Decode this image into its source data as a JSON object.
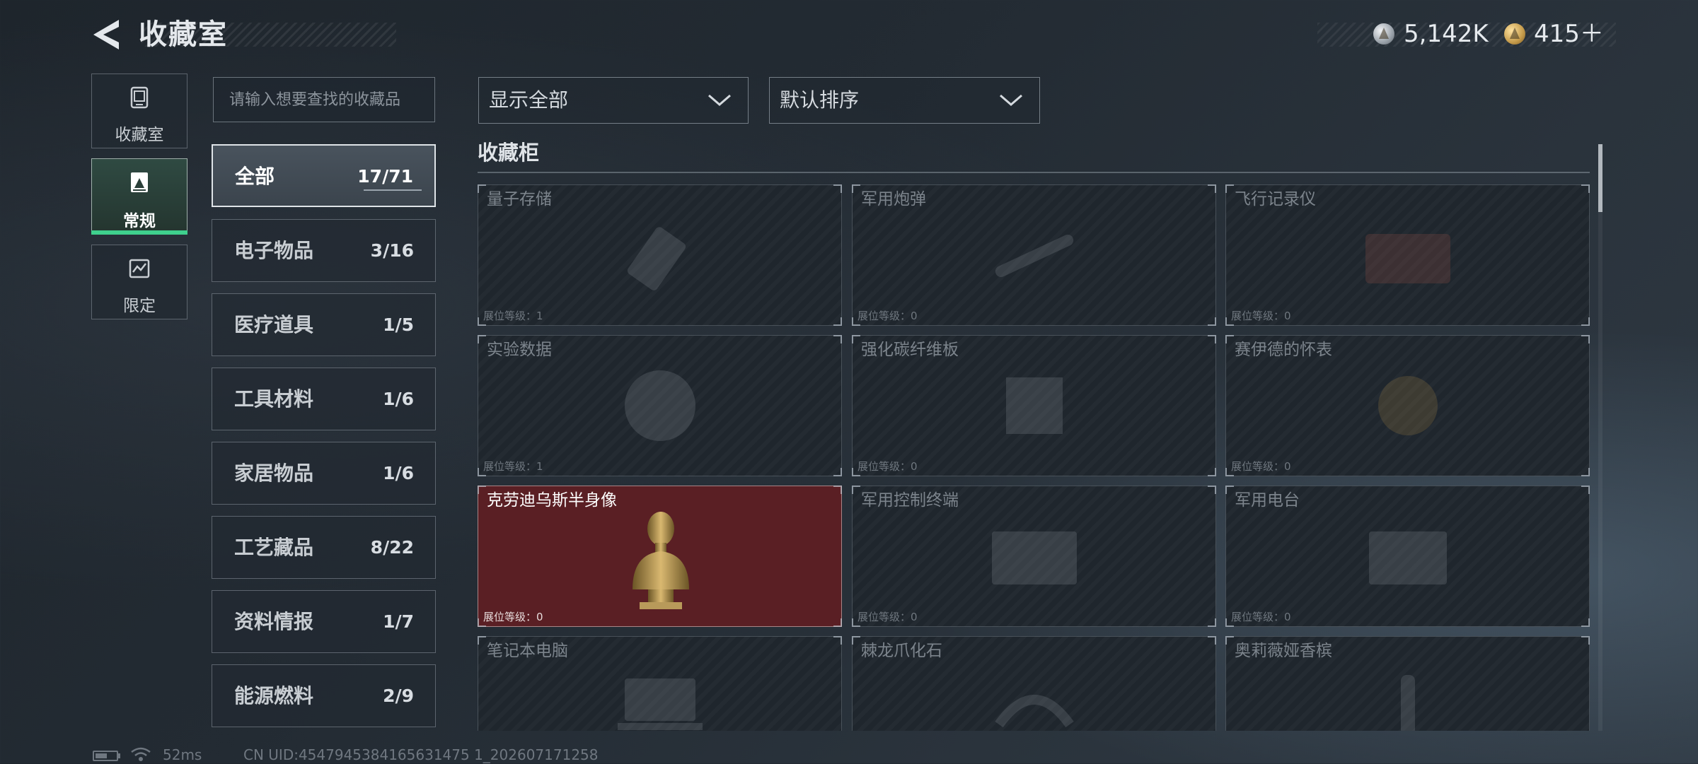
{
  "header": {
    "title": "收藏室",
    "currencies": [
      {
        "icon": "silver-coin-icon",
        "amount": "5,142K"
      },
      {
        "icon": "gold-coin-icon",
        "amount": "415＋"
      }
    ]
  },
  "mode_tabs": [
    {
      "icon": "collection-room-icon",
      "label": "收藏室",
      "active": false
    },
    {
      "icon": "regular-icon",
      "label": "常规",
      "active": true
    },
    {
      "icon": "limited-icon",
      "label": "限定",
      "active": false
    }
  ],
  "search": {
    "placeholder": "请输入想要查找的收藏品"
  },
  "categories": [
    {
      "label": "全部",
      "count": "17/71",
      "active": true
    },
    {
      "label": "电子物品",
      "count": "3/16"
    },
    {
      "label": "医疗道具",
      "count": "1/5"
    },
    {
      "label": "工具材料",
      "count": "1/6"
    },
    {
      "label": "家居物品",
      "count": "1/6"
    },
    {
      "label": "工艺藏品",
      "count": "8/22"
    },
    {
      "label": "资料情报",
      "count": "1/7"
    },
    {
      "label": "能源燃料",
      "count": "2/9"
    }
  ],
  "filters": {
    "display": "显示全部",
    "sort": "默认排序"
  },
  "section": {
    "title": "收藏柜"
  },
  "level_prefix": "展位等级：",
  "items": [
    {
      "name": "量子存储",
      "level": "1",
      "owned": false,
      "icon": "usb-drive-icon"
    },
    {
      "name": "军用炮弹",
      "level": "0",
      "owned": false,
      "icon": "artillery-shell-icon"
    },
    {
      "name": "飞行记录仪",
      "level": "0",
      "owned": false,
      "icon": "flight-recorder-icon"
    },
    {
      "name": "实验数据",
      "level": "1",
      "owned": false,
      "icon": "data-disc-icon"
    },
    {
      "name": "强化碳纤维板",
      "level": "0",
      "owned": false,
      "icon": "carbon-plate-icon"
    },
    {
      "name": "赛伊德的怀表",
      "level": "0",
      "owned": false,
      "icon": "pocket-watch-icon"
    },
    {
      "name": "克劳迪乌斯半身像",
      "level": "0",
      "owned": true,
      "icon": "bust-icon"
    },
    {
      "name": "军用控制终端",
      "level": "0",
      "owned": false,
      "icon": "control-terminal-icon"
    },
    {
      "name": "军用电台",
      "level": "0",
      "owned": false,
      "icon": "military-radio-icon"
    },
    {
      "name": "笔记本电脑",
      "level": "",
      "owned": false,
      "icon": "laptop-icon"
    },
    {
      "name": "棘龙爪化石",
      "level": "",
      "owned": false,
      "icon": "claw-fossil-icon"
    },
    {
      "name": "奥莉薇娅香槟",
      "level": "",
      "owned": false,
      "icon": "champagne-icon"
    }
  ],
  "status_bar": {
    "ping": "52ms",
    "uid": "CN UID:4547945384165631475 1_202607171258"
  },
  "colors": {
    "accent_green": "#3fd08d",
    "owned_card": "#5a1f24",
    "background": "#232b33"
  }
}
